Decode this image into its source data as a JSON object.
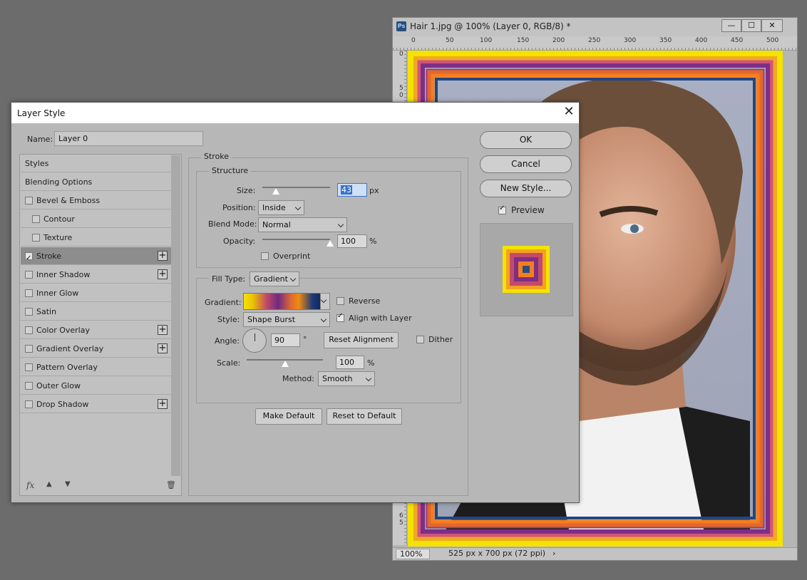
{
  "document": {
    "title": "Hair 1.jpg @ 100% (Layer 0, RGB/8) *",
    "ps_badge": "Ps",
    "ruler_top": [
      "0",
      "50",
      "100",
      "150",
      "200",
      "250",
      "300",
      "350",
      "400",
      "450",
      "500"
    ],
    "ruler_left": [
      "0",
      "5",
      "0",
      "6",
      "5"
    ],
    "zoom": "100%",
    "info": "525 px x 700 px (72 ppi)",
    "win_buttons": [
      "—",
      "☐",
      "✕"
    ]
  },
  "dialog": {
    "title": "Layer Style",
    "name_label": "Name:",
    "name_value": "Layer 0",
    "style_list": [
      {
        "label": "Styles",
        "checkbox": false,
        "checked": false,
        "plus": false,
        "indent": 0,
        "selected": false
      },
      {
        "label": "Blending Options",
        "checkbox": false,
        "checked": false,
        "plus": false,
        "indent": 0,
        "selected": false
      },
      {
        "label": "Bevel & Emboss",
        "checkbox": true,
        "checked": false,
        "plus": false,
        "indent": 0,
        "selected": false
      },
      {
        "label": "Contour",
        "checkbox": true,
        "checked": false,
        "plus": false,
        "indent": 1,
        "selected": false
      },
      {
        "label": "Texture",
        "checkbox": true,
        "checked": false,
        "plus": false,
        "indent": 1,
        "selected": false
      },
      {
        "label": "Stroke",
        "checkbox": true,
        "checked": true,
        "plus": true,
        "indent": 0,
        "selected": true
      },
      {
        "label": "Inner Shadow",
        "checkbox": true,
        "checked": false,
        "plus": true,
        "indent": 0,
        "selected": false
      },
      {
        "label": "Inner Glow",
        "checkbox": true,
        "checked": false,
        "plus": false,
        "indent": 0,
        "selected": false
      },
      {
        "label": "Satin",
        "checkbox": true,
        "checked": false,
        "plus": false,
        "indent": 0,
        "selected": false
      },
      {
        "label": "Color Overlay",
        "checkbox": true,
        "checked": false,
        "plus": true,
        "indent": 0,
        "selected": false
      },
      {
        "label": "Gradient Overlay",
        "checkbox": true,
        "checked": false,
        "plus": true,
        "indent": 0,
        "selected": false
      },
      {
        "label": "Pattern Overlay",
        "checkbox": true,
        "checked": false,
        "plus": false,
        "indent": 0,
        "selected": false
      },
      {
        "label": "Outer Glow",
        "checkbox": true,
        "checked": false,
        "plus": false,
        "indent": 0,
        "selected": false
      },
      {
        "label": "Drop Shadow",
        "checkbox": true,
        "checked": false,
        "plus": true,
        "indent": 0,
        "selected": false
      }
    ],
    "footer_icons": {
      "fx": "fx",
      "up": "▲",
      "down": "▼",
      "trash": "🗑"
    },
    "stroke": {
      "title": "Stroke",
      "structure": {
        "title": "Structure",
        "size_label": "Size:",
        "size_value": "43",
        "size_unit": "px",
        "size_level": 0.2,
        "position_label": "Position:",
        "position_value": "Inside",
        "blend_label": "Blend Mode:",
        "blend_value": "Normal",
        "opacity_label": "Opacity:",
        "opacity_value": "100",
        "opacity_unit": "%",
        "opacity_level": 1.0,
        "overprint_label": "Overprint",
        "overprint_checked": false
      },
      "fill": {
        "fill_type_label": "Fill Type:",
        "fill_type_value": "Gradient",
        "gradient_label": "Gradient:",
        "reverse_label": "Reverse",
        "reverse_checked": false,
        "style_label": "Style:",
        "style_value": "Shape Burst",
        "align_label": "Align with Layer",
        "align_checked": true,
        "angle_label": "Angle:",
        "angle_value": "90",
        "angle_unit": "°",
        "reset_alignment": "Reset Alignment",
        "dither_label": "Dither",
        "dither_checked": false,
        "scale_label": "Scale:",
        "scale_value": "100",
        "scale_unit": "%",
        "scale_level": 0.5,
        "method_label": "Method:",
        "method_value": "Smooth"
      },
      "make_default": "Make Default",
      "reset_default": "Reset to Default"
    },
    "buttons": {
      "ok": "OK",
      "cancel": "Cancel",
      "new_style": "New Style..."
    },
    "preview_label": "Preview",
    "preview_checked": true
  }
}
